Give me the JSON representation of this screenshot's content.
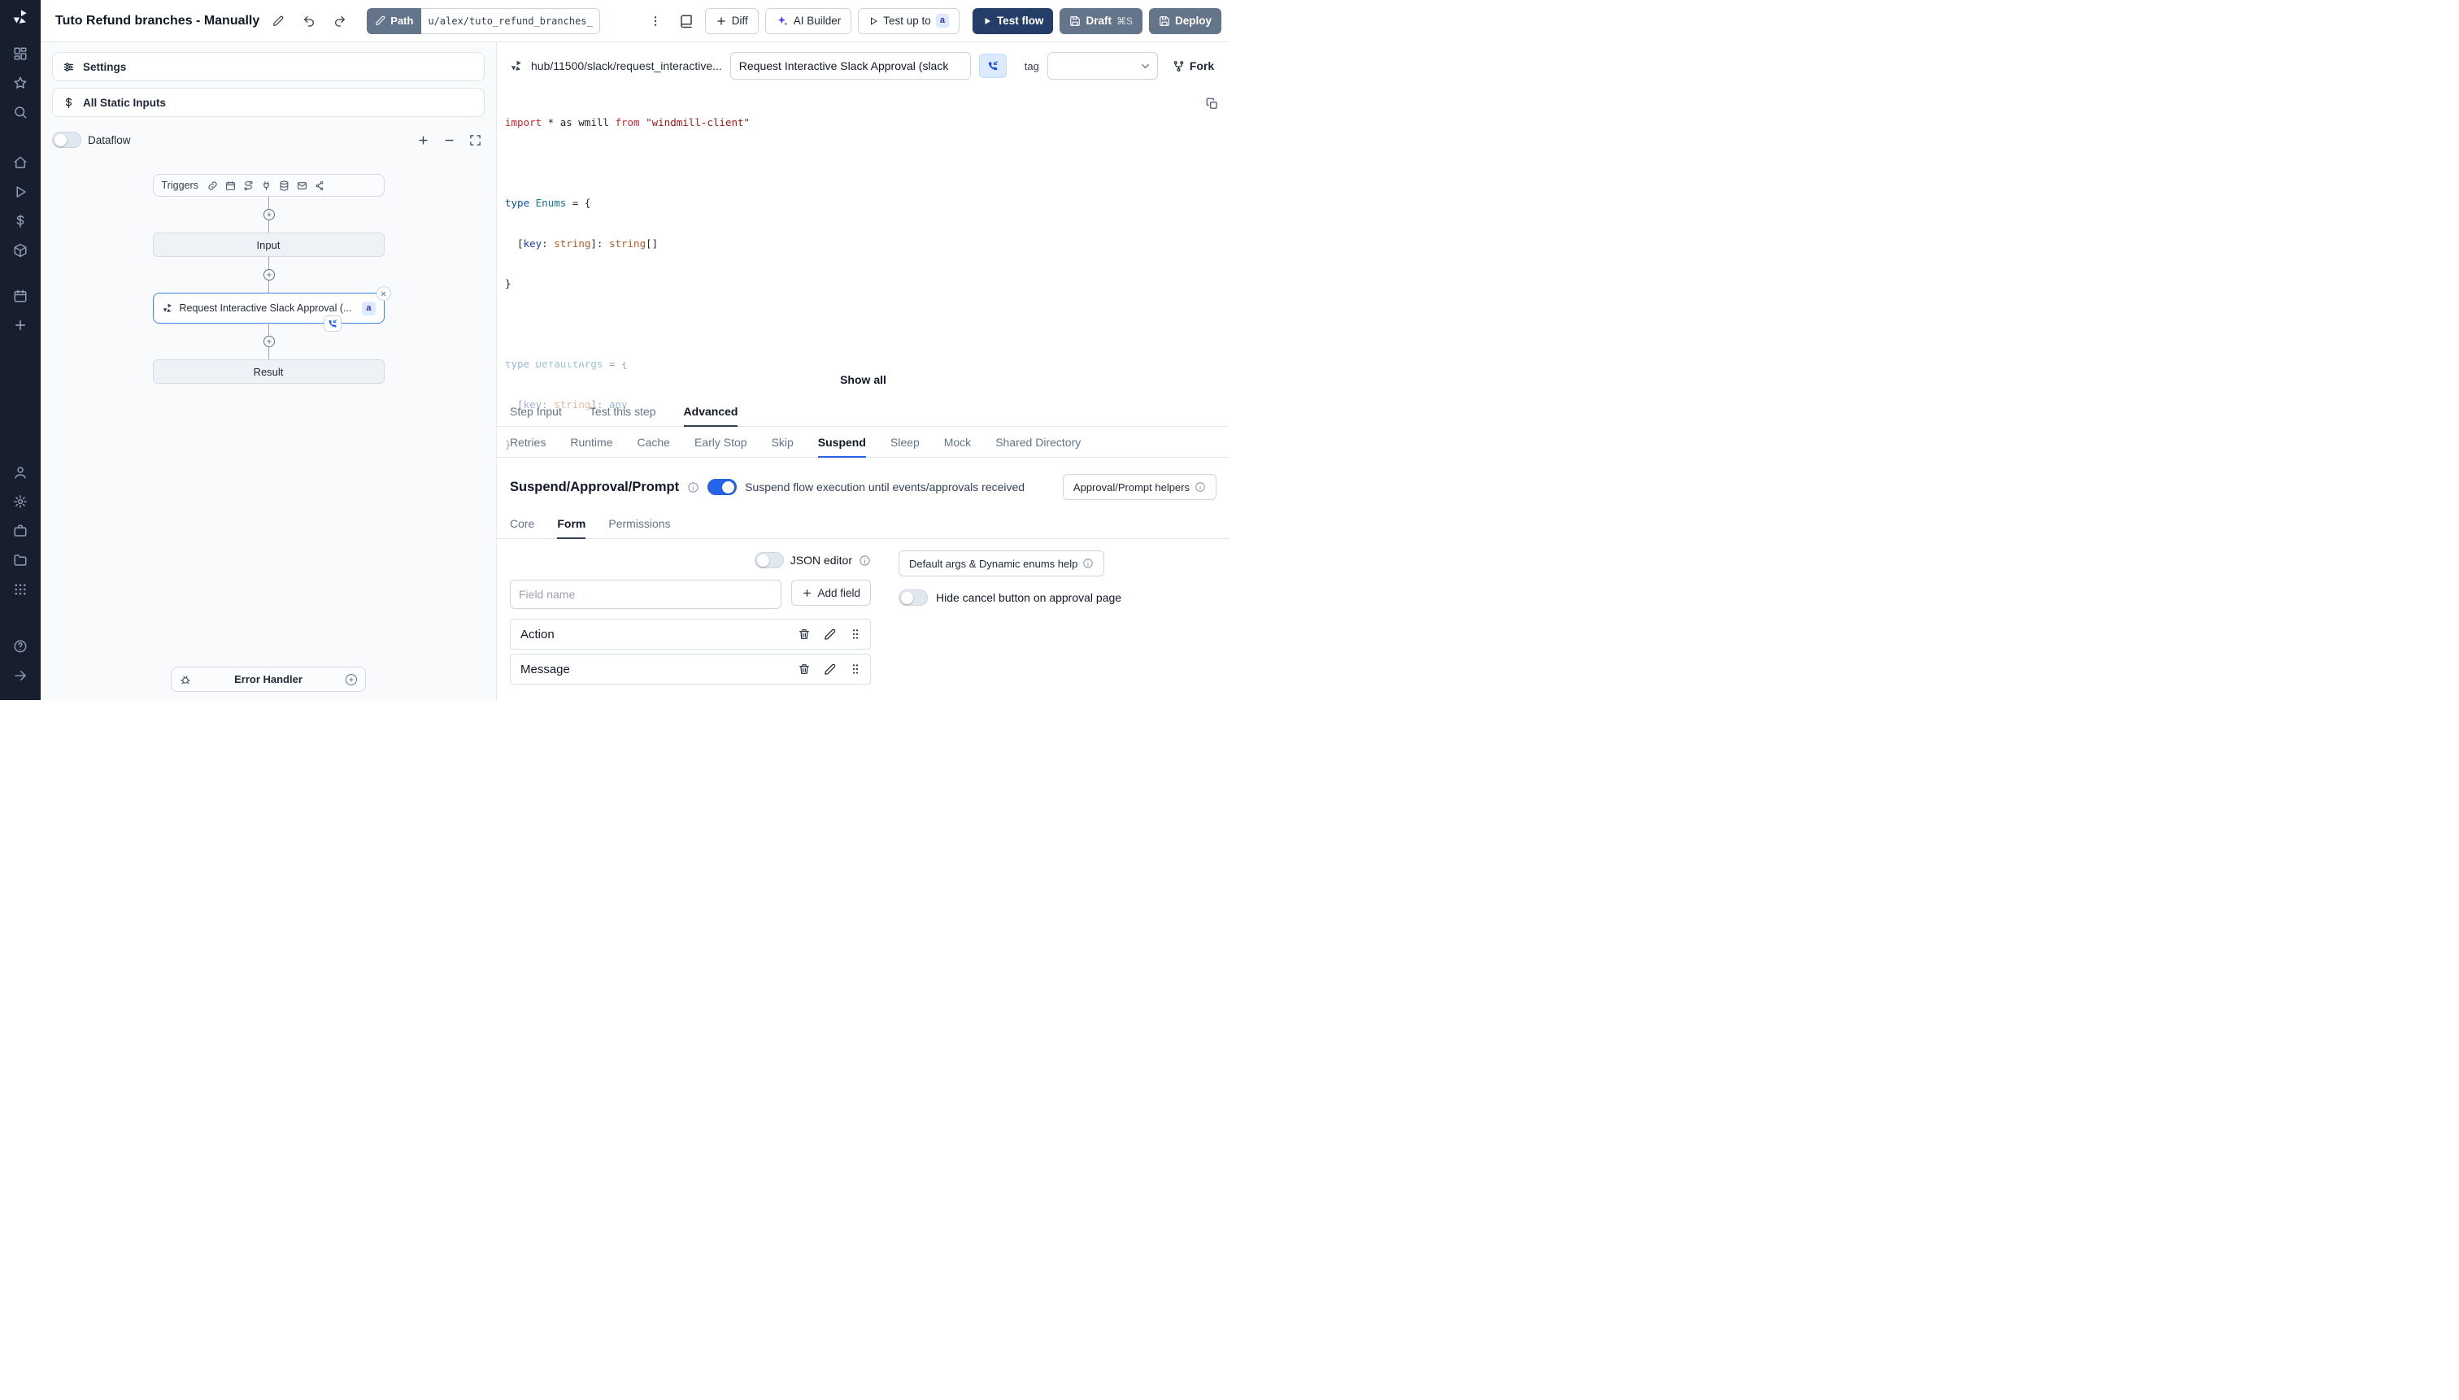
{
  "sidebar": {
    "icons": [
      "dashboard",
      "favorites",
      "search",
      "home",
      "runs",
      "variables",
      "resources",
      "schedules",
      "create",
      "account",
      "settings",
      "workers",
      "folders",
      "groups",
      "help",
      "collapse"
    ]
  },
  "topbar": {
    "title": "Tuto Refund branches - Manually",
    "path": {
      "label": "Path",
      "value": "u/alex/tuto_refund_branches__"
    },
    "diff": "Diff",
    "ai_builder": "AI Builder",
    "test_up_to": {
      "label": "Test up to",
      "badge": "a"
    },
    "test_flow": "Test flow",
    "draft": {
      "label": "Draft",
      "shortcut": "⌘S"
    },
    "deploy": "Deploy"
  },
  "left_panel": {
    "settings": "Settings",
    "static_inputs": "All Static Inputs",
    "dataflow": "Dataflow",
    "graph": {
      "triggers": "Triggers",
      "input": "Input",
      "step": {
        "label": "Request Interactive Slack Approval (...",
        "badge": "a"
      },
      "result": "Result",
      "error_handler": "Error Handler"
    }
  },
  "step_panel": {
    "hub_path": "hub/11500/slack/request_interactive...",
    "name_value": "Request Interactive Slack Approval (slack",
    "tag_label": "tag",
    "fork": "Fork",
    "show_all": "Show all",
    "code": {
      "l1": [
        "import",
        " * as wmill ",
        "from",
        " ",
        "\"windmill-client\""
      ],
      "l3": [
        "type",
        " ",
        "Enums",
        " = {"
      ],
      "l4": [
        "  [",
        "key",
        ": ",
        "string",
        "]: ",
        "string",
        "[]"
      ],
      "l5": "}",
      "l7": [
        "type",
        " ",
        "DefaultArgs",
        " = {"
      ],
      "l8": [
        "  [",
        "key",
        ": ",
        "string",
        "]: ",
        "any"
      ],
      "l9": "}"
    },
    "tabs": {
      "step_input": "Step Input",
      "test_this_step": "Test this step",
      "advanced": "Advanced"
    },
    "advanced_tabs": [
      "Retries",
      "Runtime",
      "Cache",
      "Early Stop",
      "Skip",
      "Suspend",
      "Sleep",
      "Mock",
      "Shared Directory"
    ],
    "suspend": {
      "title": "Suspend/Approval/Prompt",
      "toggle_text": "Suspend flow execution until events/approvals received",
      "helpers_button": "Approval/Prompt helpers",
      "tabs": [
        "Core",
        "Form",
        "Permissions"
      ],
      "json_editor": "JSON editor",
      "field_name_placeholder": "Field name",
      "add_field": "Add field",
      "default_args_button": "Default args & Dynamic enums help",
      "hide_cancel": "Hide cancel button on approval page",
      "fields": [
        "Action",
        "Message"
      ]
    }
  }
}
